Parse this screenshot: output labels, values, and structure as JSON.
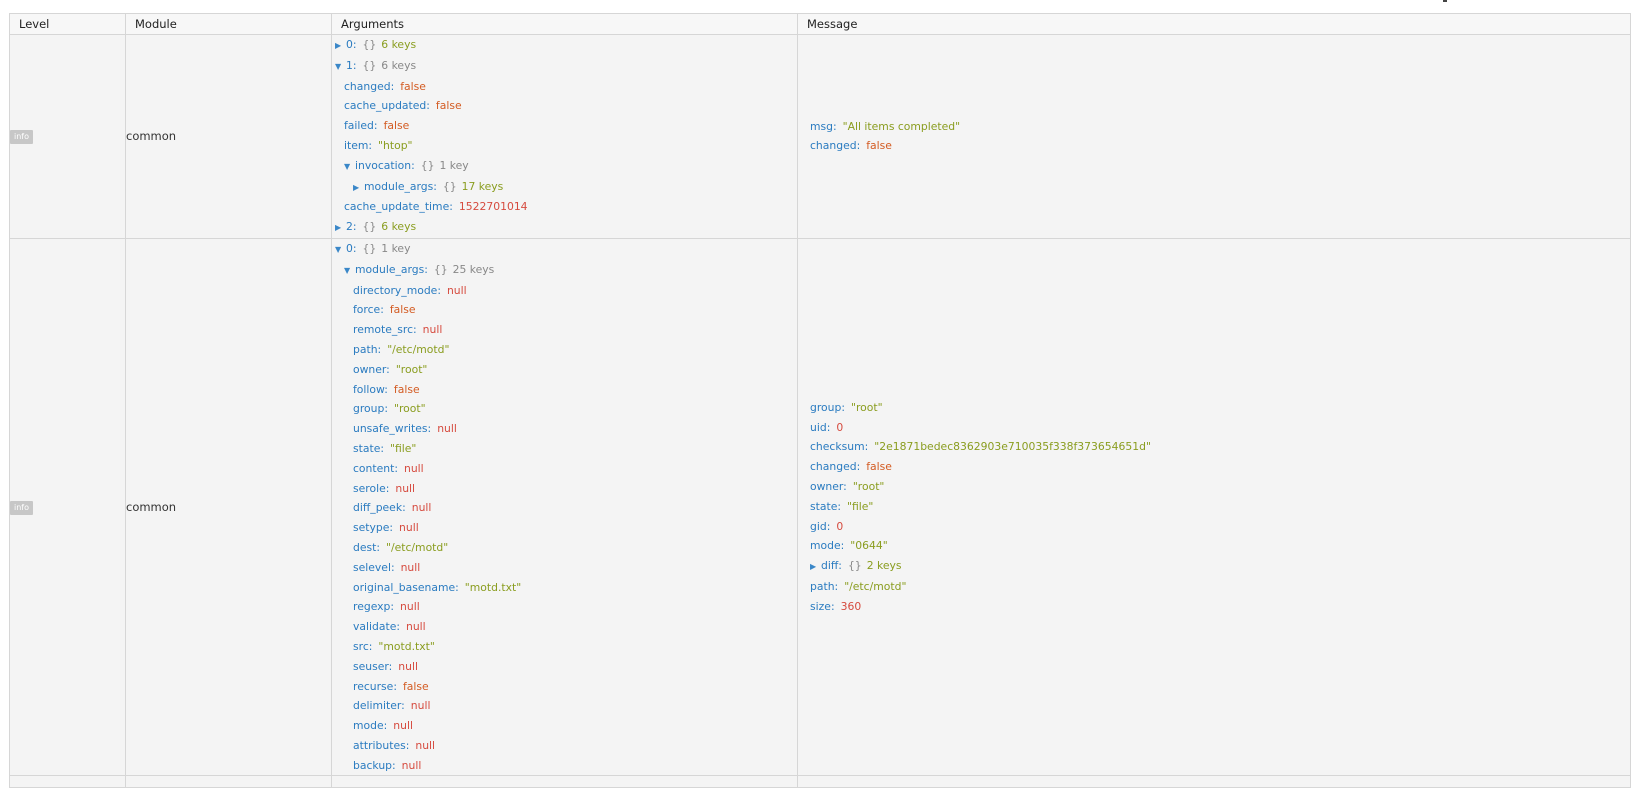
{
  "table": {
    "headers": {
      "level": "Level",
      "module": "Module",
      "arguments": "Arguments",
      "message": "Message"
    }
  },
  "rows": [
    {
      "level": "info",
      "module": "common",
      "arguments": [
        {
          "depth": 0,
          "toggle": "closed",
          "key": "0",
          "brace": "{}",
          "count": "6 keys",
          "count_color": "green"
        },
        {
          "depth": 0,
          "toggle": "open",
          "key": "1",
          "brace": "{}",
          "count": "6 keys",
          "count_color": "grey"
        },
        {
          "depth": 1,
          "key": "changed",
          "value": "false",
          "type": "boolean"
        },
        {
          "depth": 1,
          "key": "cache_updated",
          "value": "false",
          "type": "boolean"
        },
        {
          "depth": 1,
          "key": "failed",
          "value": "false",
          "type": "boolean"
        },
        {
          "depth": 1,
          "key": "item",
          "value": "\"htop\"",
          "type": "string"
        },
        {
          "depth": 1,
          "toggle": "open",
          "key": "invocation",
          "brace": "{}",
          "count": "1 key",
          "count_color": "grey"
        },
        {
          "depth": 2,
          "toggle": "closed",
          "key": "module_args",
          "brace": "{}",
          "count": "17 keys",
          "count_color": "green"
        },
        {
          "depth": 1,
          "key": "cache_update_time",
          "value": "1522701014",
          "type": "number"
        },
        {
          "depth": 0,
          "toggle": "closed",
          "key": "2",
          "brace": "{}",
          "count": "6 keys",
          "count_color": "green"
        }
      ],
      "message": [
        {
          "depth": 1,
          "key": "msg",
          "value": "\"All items completed\"",
          "type": "string"
        },
        {
          "depth": 1,
          "key": "changed",
          "value": "false",
          "type": "boolean"
        }
      ]
    },
    {
      "level": "info",
      "module": "common",
      "arguments": [
        {
          "depth": 0,
          "toggle": "open",
          "key": "0",
          "brace": "{}",
          "count": "1 key",
          "count_color": "grey"
        },
        {
          "depth": 1,
          "toggle": "open",
          "key": "module_args",
          "brace": "{}",
          "count": "25 keys",
          "count_color": "grey"
        },
        {
          "depth": 2,
          "key": "directory_mode",
          "value": "null",
          "type": "null"
        },
        {
          "depth": 2,
          "key": "force",
          "value": "false",
          "type": "boolean"
        },
        {
          "depth": 2,
          "key": "remote_src",
          "value": "null",
          "type": "null"
        },
        {
          "depth": 2,
          "key": "path",
          "value": "\"/etc/motd\"",
          "type": "string"
        },
        {
          "depth": 2,
          "key": "owner",
          "value": "\"root\"",
          "type": "string"
        },
        {
          "depth": 2,
          "key": "follow",
          "value": "false",
          "type": "boolean"
        },
        {
          "depth": 2,
          "key": "group",
          "value": "\"root\"",
          "type": "string"
        },
        {
          "depth": 2,
          "key": "unsafe_writes",
          "value": "null",
          "type": "null"
        },
        {
          "depth": 2,
          "key": "state",
          "value": "\"file\"",
          "type": "string"
        },
        {
          "depth": 2,
          "key": "content",
          "value": "null",
          "type": "null"
        },
        {
          "depth": 2,
          "key": "serole",
          "value": "null",
          "type": "null"
        },
        {
          "depth": 2,
          "key": "diff_peek",
          "value": "null",
          "type": "null"
        },
        {
          "depth": 2,
          "key": "setype",
          "value": "null",
          "type": "null"
        },
        {
          "depth": 2,
          "key": "dest",
          "value": "\"/etc/motd\"",
          "type": "string"
        },
        {
          "depth": 2,
          "key": "selevel",
          "value": "null",
          "type": "null"
        },
        {
          "depth": 2,
          "key": "original_basename",
          "value": "\"motd.txt\"",
          "type": "string"
        },
        {
          "depth": 2,
          "key": "regexp",
          "value": "null",
          "type": "null"
        },
        {
          "depth": 2,
          "key": "validate",
          "value": "null",
          "type": "null"
        },
        {
          "depth": 2,
          "key": "src",
          "value": "\"motd.txt\"",
          "type": "string"
        },
        {
          "depth": 2,
          "key": "seuser",
          "value": "null",
          "type": "null"
        },
        {
          "depth": 2,
          "key": "recurse",
          "value": "false",
          "type": "boolean"
        },
        {
          "depth": 2,
          "key": "delimiter",
          "value": "null",
          "type": "null"
        },
        {
          "depth": 2,
          "key": "mode",
          "value": "null",
          "type": "null"
        },
        {
          "depth": 2,
          "key": "attributes",
          "value": "null",
          "type": "null"
        },
        {
          "depth": 2,
          "key": "backup",
          "value": "null",
          "type": "null"
        }
      ],
      "message": [
        {
          "depth": 1,
          "key": "group",
          "value": "\"root\"",
          "type": "string"
        },
        {
          "depth": 1,
          "key": "uid",
          "value": "0",
          "type": "number"
        },
        {
          "depth": 1,
          "key": "checksum",
          "value": "\"2e1871bedec8362903e710035f338f373654651d\"",
          "type": "string"
        },
        {
          "depth": 1,
          "key": "changed",
          "value": "false",
          "type": "boolean"
        },
        {
          "depth": 1,
          "key": "owner",
          "value": "\"root\"",
          "type": "string"
        },
        {
          "depth": 1,
          "key": "state",
          "value": "\"file\"",
          "type": "string"
        },
        {
          "depth": 1,
          "key": "gid",
          "value": "0",
          "type": "number"
        },
        {
          "depth": 1,
          "key": "mode",
          "value": "\"0644\"",
          "type": "string"
        },
        {
          "depth": 1,
          "toggle": "closed",
          "key": "diff",
          "brace": "{}",
          "count": "2 keys",
          "count_color": "green"
        },
        {
          "depth": 1,
          "key": "path",
          "value": "\"/etc/motd\"",
          "type": "string"
        },
        {
          "depth": 1,
          "key": "size",
          "value": "360",
          "type": "number"
        }
      ]
    }
  ],
  "colors": {
    "key": "#2a7bc0",
    "string": "#8a9d1f",
    "boolean": "#d35b22",
    "null": "#d64b3f",
    "number": "#d64b3f",
    "count_grey": "#888888",
    "badge": "#c7c7c7"
  },
  "icons": {
    "expanded": "triangle-down-icon",
    "collapsed": "triangle-right-icon"
  }
}
